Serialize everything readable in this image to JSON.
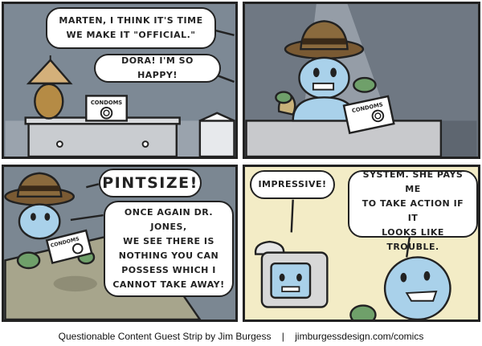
{
  "panels": [
    {
      "bubbles": [
        "MARTEN, I THINK IT'S TIME\nWE MAKE IT \"OFFICIAL.\"",
        "DORA! I'M SO HAPPY!"
      ],
      "box_label": "CONDOMS"
    },
    {
      "box_label": "CONDOMS"
    },
    {
      "bubbles": [
        "PINTSIZE!",
        "ONCE AGAIN DR. JONES,\nWE SEE THERE IS\nNOTHING YOU CAN\nPOSSESS WHICH I\nCANNOT TAKE AWAY!"
      ],
      "box_label": "CONDOMS"
    },
    {
      "bubbles": [
        "IMPRESSIVE!",
        "I'M ON THE FAYEPAL\nSYSTEM. SHE PAYS ME\nTO TAKE ACTION IF IT\nLOOKS LIKE TROUBLE."
      ]
    }
  ],
  "credit": {
    "left": "Questionable Content Guest Strip by Jim Burgess",
    "separator": "|",
    "right": "jimburgessdesign.com/comics"
  }
}
